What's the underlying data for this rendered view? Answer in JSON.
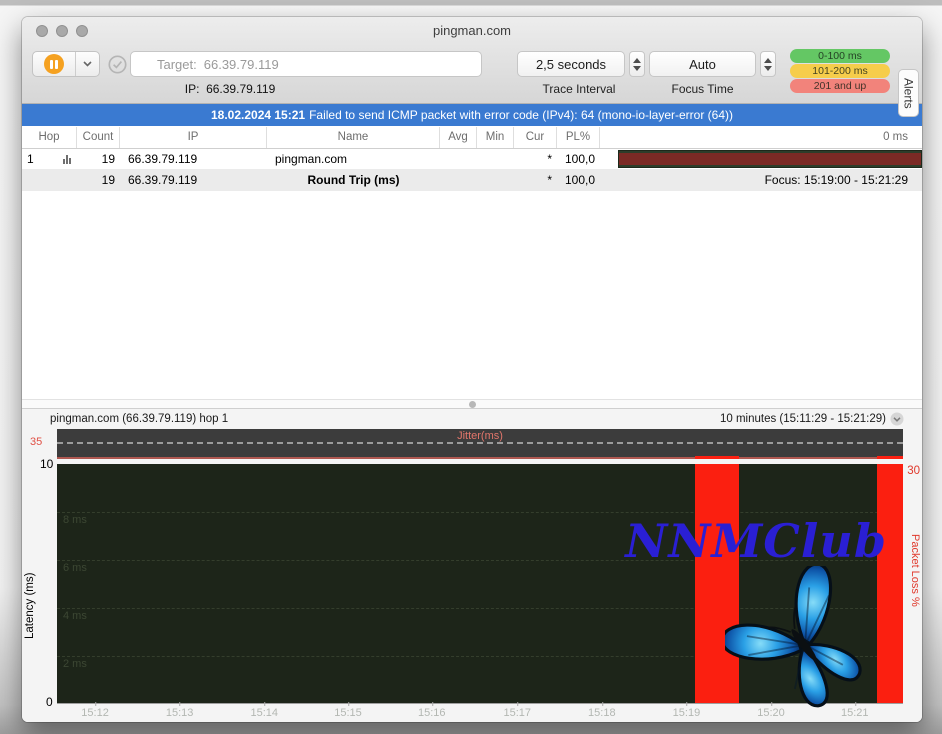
{
  "window": {
    "title": "pingman.com"
  },
  "toolbar": {
    "target_label": "Target:",
    "target_value": "66.39.79.119",
    "ip_label": "IP:",
    "ip_value": "66.39.79.119",
    "trace_interval_value": "2,5 seconds",
    "trace_interval_label": "Trace Interval",
    "focus_time_value": "Auto",
    "focus_time_label": "Focus Time",
    "legend": [
      {
        "label": "0-100 ms",
        "color": "#64c764"
      },
      {
        "label": "101-200 ms",
        "color": "#f6cd4b"
      },
      {
        "label": "201 and up",
        "color": "#f2837b"
      }
    ],
    "alerts_tab": "Alerts"
  },
  "banner": {
    "timestamp": "18.02.2024 15:21",
    "message": "Failed to send ICMP packet with error code (IPv4): 64 (mono-io-layer-error (64))"
  },
  "table": {
    "columns": [
      "Hop",
      "Count",
      "IP",
      "Name",
      "Avg",
      "Min",
      "Cur",
      "PL%"
    ],
    "graph_scale_label": "0 ms",
    "hop_row": {
      "hop": "1",
      "count": "19",
      "ip": "66.39.79.119",
      "name": "pingman.com",
      "avg": "",
      "min": "",
      "cur": "*",
      "pl": "100,0"
    },
    "summary_row": {
      "count": "19",
      "ip": "66.39.79.119",
      "name": "Round Trip (ms)",
      "cur": "*",
      "pl": "100,0",
      "focus": "Focus: 15:19:00 - 15:21:29"
    }
  },
  "graph": {
    "pane_title": "pingman.com (66.39.79.119) hop 1",
    "time_range": "10 minutes (15:11:29 - 15:21:29)",
    "jitter_label": "Jitter(ms)",
    "jitter_scale": "35",
    "latency_max": "10",
    "latency_min": "0",
    "latency_axis_label": "Latency (ms)",
    "packet_loss_scale": "30",
    "packet_loss_axis_label": "Packet Loss %",
    "gridlines": [
      "8 ms",
      "6 ms",
      "4 ms",
      "2 ms"
    ],
    "x_ticks": [
      "15:12",
      "15:13",
      "15:14",
      "15:15",
      "15:16",
      "15:17",
      "15:18",
      "15:19",
      "15:20",
      "15:21"
    ],
    "watermark": "NNMClub",
    "loss_bars": [
      {
        "left_pct": 75.4,
        "width_pct": 5.2
      },
      {
        "left_pct": 96.9,
        "width_pct": 3.1
      }
    ],
    "colors": {
      "loss_bar": "#fb1f10",
      "plot_bg": "#1d2519",
      "jitter_bg": "#3c3c3c",
      "banner": "#3a7ad1",
      "hop_bar_fill": "#7b2a25",
      "hop_bar_bg": "#2e3d2a",
      "watermark": "#2a1fd4"
    }
  }
}
